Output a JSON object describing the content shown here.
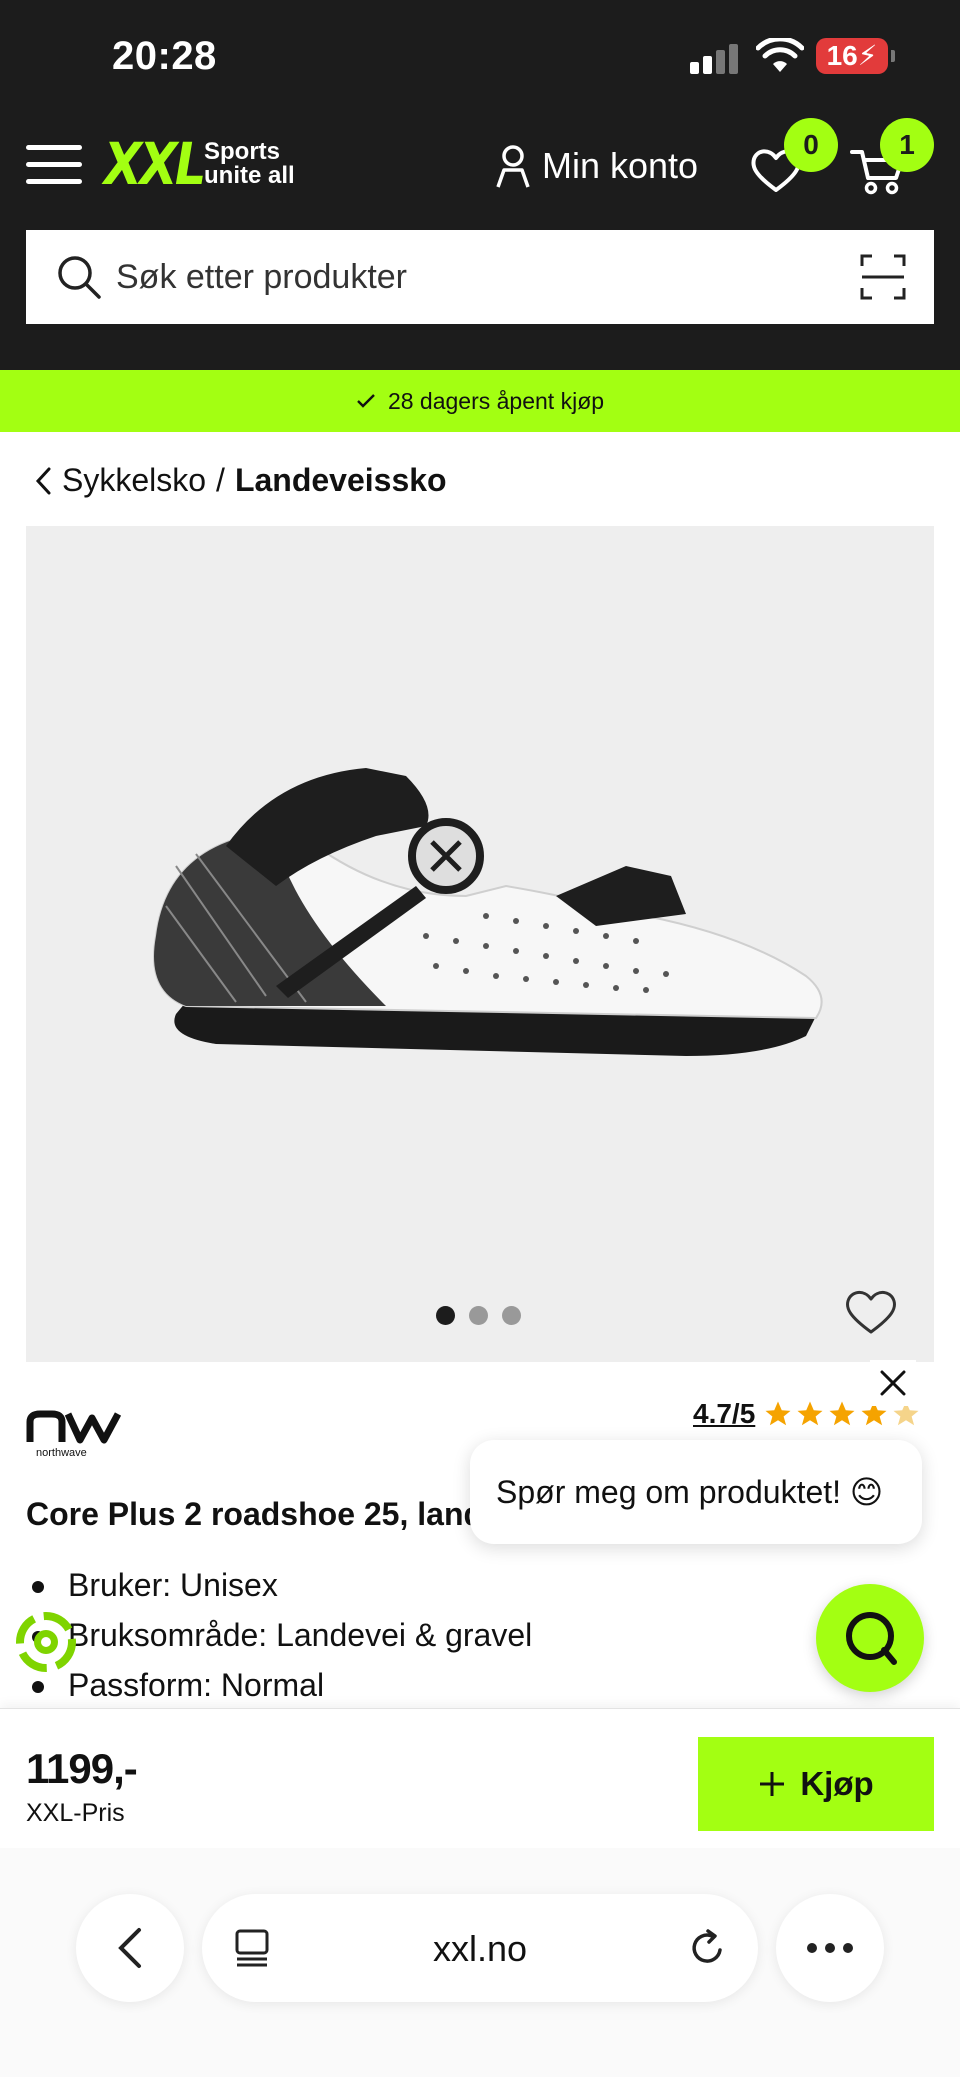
{
  "status_bar": {
    "time": "20:28",
    "battery": "16"
  },
  "header": {
    "logo_text": "XXL",
    "logo_tagline": "Sports unite all",
    "account_label": "Min konto",
    "wishlist_count": "0",
    "cart_count": "1",
    "brand_color": "#a3ff12"
  },
  "search": {
    "placeholder": "Søk etter produkter"
  },
  "promo": {
    "text": "28 dagers åpent kjøp"
  },
  "breadcrumb": {
    "parent": "Sykkelsko",
    "separator": "/",
    "current": "Landeveisско"
  },
  "gallery": {
    "image_count": 3,
    "active_index": 0
  },
  "product": {
    "brand": "northwave",
    "rating": "4.7/5",
    "rating_value": 4.7,
    "title": "Core Plus 2 roadshoe 25, landeveissko",
    "specs": [
      "Bruker: Unisex",
      "Bruksområde: Landevei & gravel",
      "Passform: Normal"
    ]
  },
  "chat": {
    "prompt": "Spør meg om produktet! 😊"
  },
  "buybar": {
    "price": "1199,-",
    "price_label": "XXL-Pris",
    "buy_label": "Kjøp"
  },
  "browser": {
    "url": "xxl.no"
  }
}
